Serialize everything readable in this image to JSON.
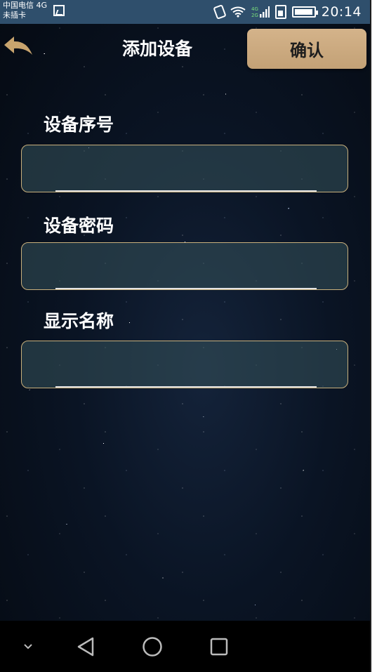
{
  "status_bar": {
    "carrier_line1": "中国电信 4G",
    "carrier_line2": "未插卡",
    "time": "20:14",
    "icons": [
      "gallery-icon",
      "vibrate-icon",
      "wifi-icon",
      "signal-4g-2g-icon",
      "sim-icon",
      "battery-icon"
    ]
  },
  "header": {
    "back_icon": "back-arrow-icon",
    "title": "添加设备",
    "confirm_label": "确认"
  },
  "form": {
    "fields": [
      {
        "label": "设备序号",
        "value": "",
        "placeholder": ""
      },
      {
        "label": "设备密码",
        "value": "",
        "placeholder": ""
      },
      {
        "label": "显示名称",
        "value": "",
        "placeholder": ""
      }
    ]
  },
  "nav_bar": {
    "icons": [
      "chevron-down-icon",
      "back-triangle-icon",
      "home-circle-icon",
      "recent-square-icon"
    ]
  },
  "colors": {
    "status_bar_bg": "#2f4f6c",
    "confirm_bg": "#c9a97d",
    "field_border": "#c9b07c",
    "field_bg": "#345058"
  }
}
